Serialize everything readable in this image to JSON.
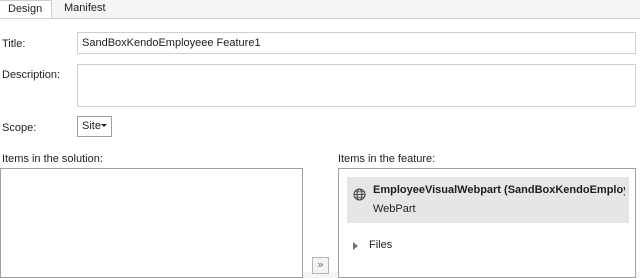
{
  "tabs": [
    {
      "label": "Design",
      "active": true
    },
    {
      "label": "Manifest",
      "active": false
    }
  ],
  "form": {
    "title_label": "Title:",
    "title_value": "SandBoxKendoEmployeee Feature1",
    "description_label": "Description:",
    "description_value": "",
    "scope_label": "Scope:",
    "scope_value": "Site"
  },
  "solution": {
    "label": "Items in the solution:",
    "items": []
  },
  "feature": {
    "label": "Items in the feature:",
    "items": [
      {
        "title": "EmployeeVisualWebpart (SandBoxKendoEmploye...",
        "subtitle": "WebPart",
        "icon": "globe-icon",
        "selected": true
      }
    ],
    "folders": [
      {
        "label": "Files",
        "expanded": false
      }
    ]
  },
  "move_button_glyph": "»",
  "colors": {
    "selected_item_bg": "#e6e6e6",
    "border": "#cccedb"
  }
}
